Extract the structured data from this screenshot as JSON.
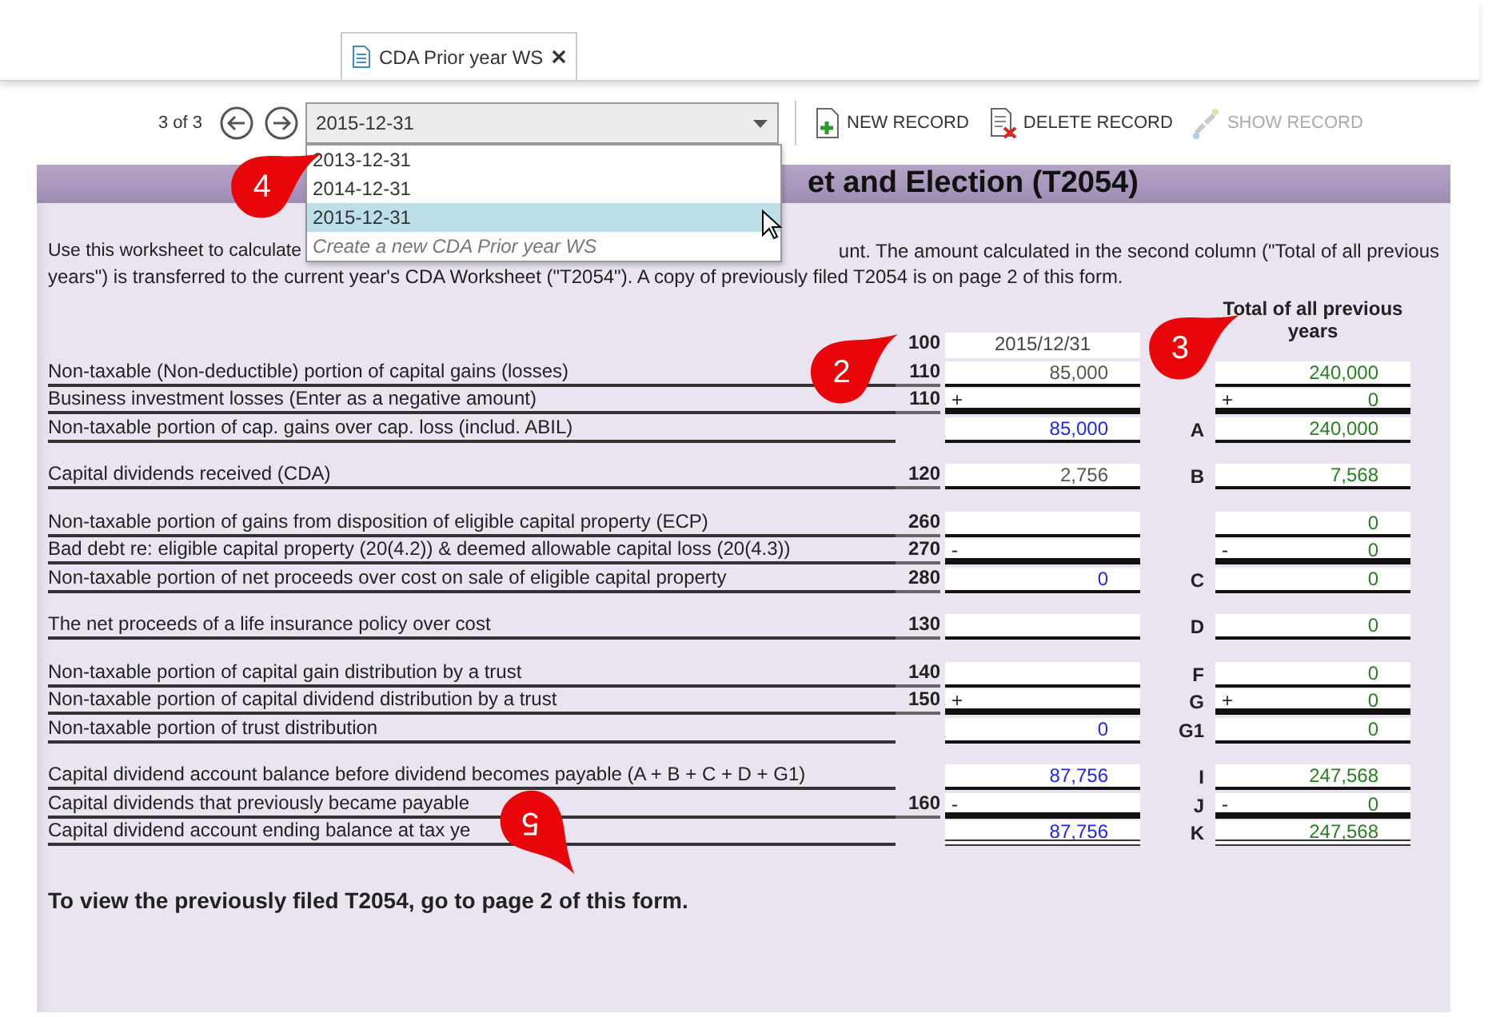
{
  "tab": {
    "title": "CDA Prior year WS",
    "selected": true
  },
  "toolbar": {
    "record_position": "3 of 3",
    "record_select": {
      "value": "2015-12-31",
      "expanded": true,
      "options": [
        {
          "label": "2013-12-31",
          "kind": "record",
          "selected": false
        },
        {
          "label": "2014-12-31",
          "kind": "record",
          "selected": false
        },
        {
          "label": "2015-12-31",
          "kind": "record",
          "selected": true
        },
        {
          "label": "Create a new CDA Prior year WS",
          "kind": "action",
          "selected": false
        }
      ]
    },
    "buttons": [
      {
        "label": "NEW RECORD",
        "kind": "new",
        "disabled": false
      },
      {
        "label": "DELETE RECORD",
        "kind": "delete",
        "disabled": false
      },
      {
        "label": "SHOW RECORD",
        "kind": "show",
        "disabled": true
      }
    ]
  },
  "form": {
    "title": "et and Election (T2054)",
    "intro": [
      "Use this worksheet to calculate",
      "unt. The amount calculated in the second column (\"Total of all previous",
      "years\") is transferred to the current year's CDA Worksheet (\"T2054\"). A copy of previously filed T2054 is on page 2 of this form."
    ],
    "header": {
      "code": "100",
      "date": "2015/12/31",
      "column_2_title": "Total of all previous years"
    },
    "groups": [
      [
        {
          "label": "Non-taxable (Non-deductible) portion of capital gains (losses)",
          "code": "110",
          "amount": {
            "value": "85,000",
            "kind": "entered"
          },
          "total": {
            "value": "240,000",
            "kind": "carried"
          },
          "kind": "entry"
        },
        {
          "label": "Business investment losses (Enter as a negative amount)",
          "code": "110",
          "amount": {
            "sign": "+"
          },
          "total": {
            "sign": "+",
            "value": "0",
            "kind": "carried"
          },
          "kind": "entry"
        },
        {
          "label": "Non-taxable portion of cap. gains over cap. loss (includ. ABIL)",
          "amount": {
            "value": "85,000",
            "kind": "calculated"
          },
          "letter": "A",
          "total": {
            "value": "240,000",
            "kind": "carried"
          },
          "kind": "entry"
        }
      ],
      [
        {
          "label": "Capital dividends received (CDA)",
          "code": "120",
          "amount": {
            "value": "2,756",
            "kind": "entered"
          },
          "letter": "B",
          "total": {
            "value": "7,568",
            "kind": "carried"
          },
          "kind": "entry"
        }
      ],
      [
        {
          "label": "Non-taxable portion of gains from disposition of eligible capital property (ECP)",
          "code": "260",
          "total": {
            "value": "0",
            "kind": "carried"
          },
          "kind": "entry"
        },
        {
          "label": "Bad debt re: eligible capital property (20(4.2)) & deemed allowable capital loss (20(4.3))",
          "code": "270",
          "amount": {
            "sign": "-"
          },
          "total": {
            "sign": "-",
            "value": "0",
            "kind": "carried"
          },
          "kind": "entry"
        },
        {
          "label": "Non-taxable portion of net proceeds over cost on sale of eligible capital property",
          "code": "280",
          "amount": {
            "value": "0",
            "kind": "calculated"
          },
          "letter": "C",
          "total": {
            "value": "0",
            "kind": "carried"
          },
          "kind": "entry"
        }
      ],
      [
        {
          "label": "The net proceeds of a life insurance policy over cost",
          "code": "130",
          "letter": "D",
          "total": {
            "value": "0",
            "kind": "carried"
          },
          "kind": "entry"
        }
      ],
      [
        {
          "label": "Non-taxable portion of capital gain distribution by a trust",
          "code": "140",
          "letter": "F",
          "total": {
            "value": "0",
            "kind": "carried"
          },
          "kind": "entry"
        },
        {
          "label": "Non-taxable portion of capital dividend distribution by a trust",
          "code": "150",
          "amount": {
            "sign": "+"
          },
          "letter": "G",
          "total": {
            "sign": "+",
            "value": "0",
            "kind": "carried"
          },
          "kind": "entry"
        },
        {
          "label": "Non-taxable portion of trust distribution",
          "amount": {
            "value": "0",
            "kind": "calculated"
          },
          "letter": "G1",
          "total": {
            "value": "0",
            "kind": "carried"
          },
          "kind": "entry"
        }
      ],
      [
        {
          "label": "Capital dividend account balance before dividend becomes payable (A + B + C + D + G1)",
          "amount": {
            "value": "87,756",
            "kind": "calculated"
          },
          "letter": "I",
          "total": {
            "value": "247,568",
            "kind": "carried"
          },
          "kind": "entry"
        },
        {
          "label": "Capital dividends that previously became payable",
          "code": "160",
          "amount": {
            "sign": "-"
          },
          "letter": "J",
          "total": {
            "sign": "-",
            "value": "0",
            "kind": "carried"
          },
          "kind": "entry"
        },
        {
          "label": "Capital dividend account ending balance at tax ye",
          "amount": {
            "value": "87,756",
            "kind": "calculated"
          },
          "letter": "K",
          "total": {
            "value": "247,568",
            "kind": "carried"
          },
          "kind": "final"
        }
      ]
    ],
    "footer": "To view the previously filed T2054, go to page 2 of this form."
  },
  "callouts": [
    {
      "number": "4"
    },
    {
      "number": "2"
    },
    {
      "number": "3"
    },
    {
      "number": "5"
    }
  ]
}
